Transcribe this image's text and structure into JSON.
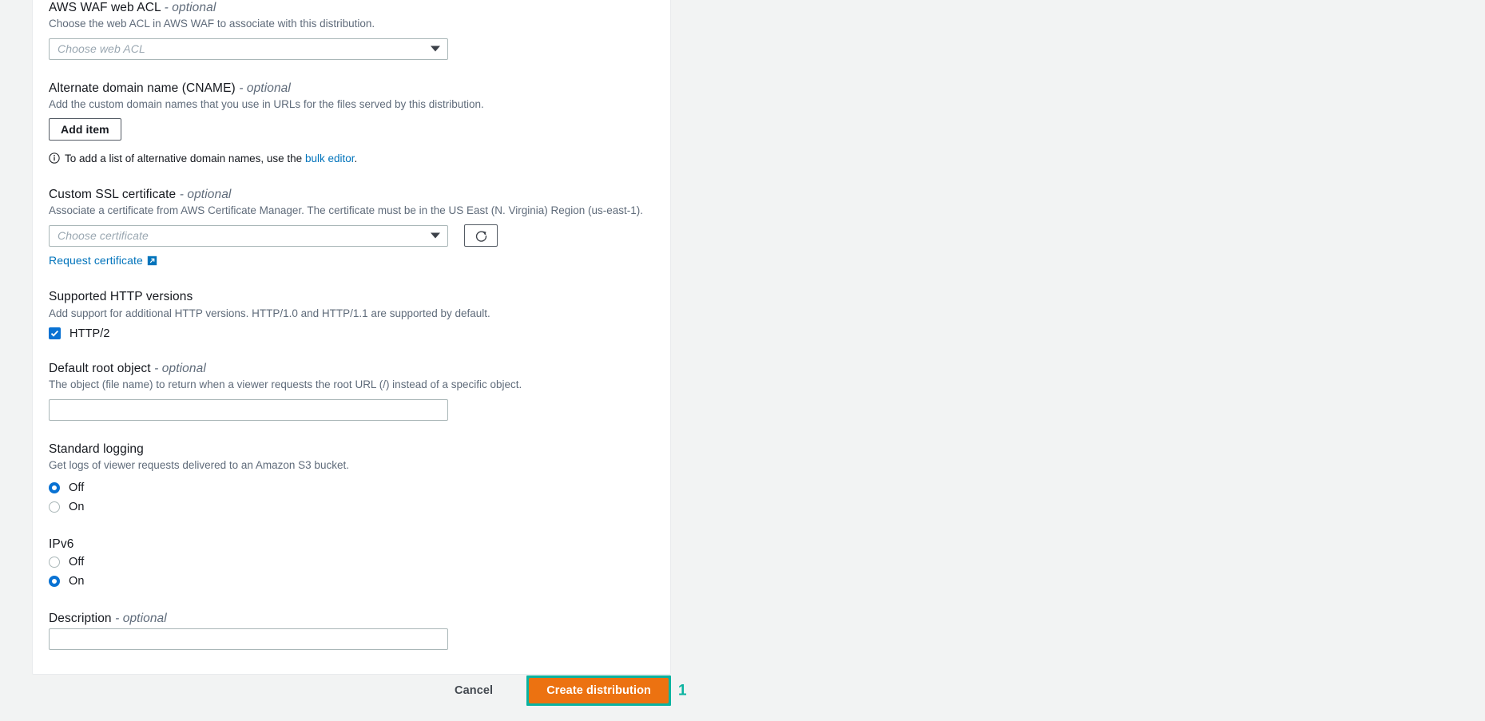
{
  "form": {
    "waf": {
      "label": "AWS WAF web ACL",
      "optional": "- optional",
      "description": "Choose the web ACL in AWS WAF to associate with this distribution.",
      "select_placeholder": "Choose web ACL"
    },
    "cname": {
      "label": "Alternate domain name (CNAME)",
      "optional": "- optional",
      "description": "Add the custom domain names that you use in URLs for the files served by this distribution.",
      "add_item_label": "Add item",
      "info_prefix": "To add a list of alternative domain names, use the ",
      "info_link": "bulk editor",
      "info_suffix": "."
    },
    "ssl": {
      "label": "Custom SSL certificate",
      "optional": "- optional",
      "description": "Associate a certificate from AWS Certificate Manager. The certificate must be in the US East (N. Virginia) Region (us-east-1).",
      "select_placeholder": "Choose certificate",
      "refresh_icon": "refresh-icon",
      "request_link": "Request certificate",
      "request_icon": "external-link-icon"
    },
    "http_versions": {
      "label": "Supported HTTP versions",
      "description": "Add support for additional HTTP versions. HTTP/1.0 and HTTP/1.1 are supported by default.",
      "checkbox_label": "HTTP/2",
      "checked": true
    },
    "root_object": {
      "label": "Default root object",
      "optional": "- optional",
      "description": "The object (file name) to return when a viewer requests the root URL (/) instead of a specific object.",
      "value": "",
      "placeholder": ""
    },
    "standard_logging": {
      "label": "Standard logging",
      "description": "Get logs of viewer requests delivered to an Amazon S3 bucket.",
      "options": [
        {
          "label": "Off",
          "selected": true
        },
        {
          "label": "On",
          "selected": false
        }
      ]
    },
    "ipv6": {
      "label": "IPv6",
      "description": "",
      "options": [
        {
          "label": "Off",
          "selected": false
        },
        {
          "label": "On",
          "selected": true
        }
      ]
    },
    "description_field": {
      "label": "Description",
      "optional": "- optional",
      "value": "",
      "placeholder": ""
    }
  },
  "footer": {
    "cancel_label": "Cancel",
    "create_label": "Create distribution",
    "annotation_marker": "1"
  },
  "colors": {
    "accent_orange": "#ec7211",
    "highlight_teal": "#0ab3a0",
    "link_blue": "#0073bb",
    "checkbox_blue": "#0972d3",
    "page_bg": "#f2f3f3"
  }
}
